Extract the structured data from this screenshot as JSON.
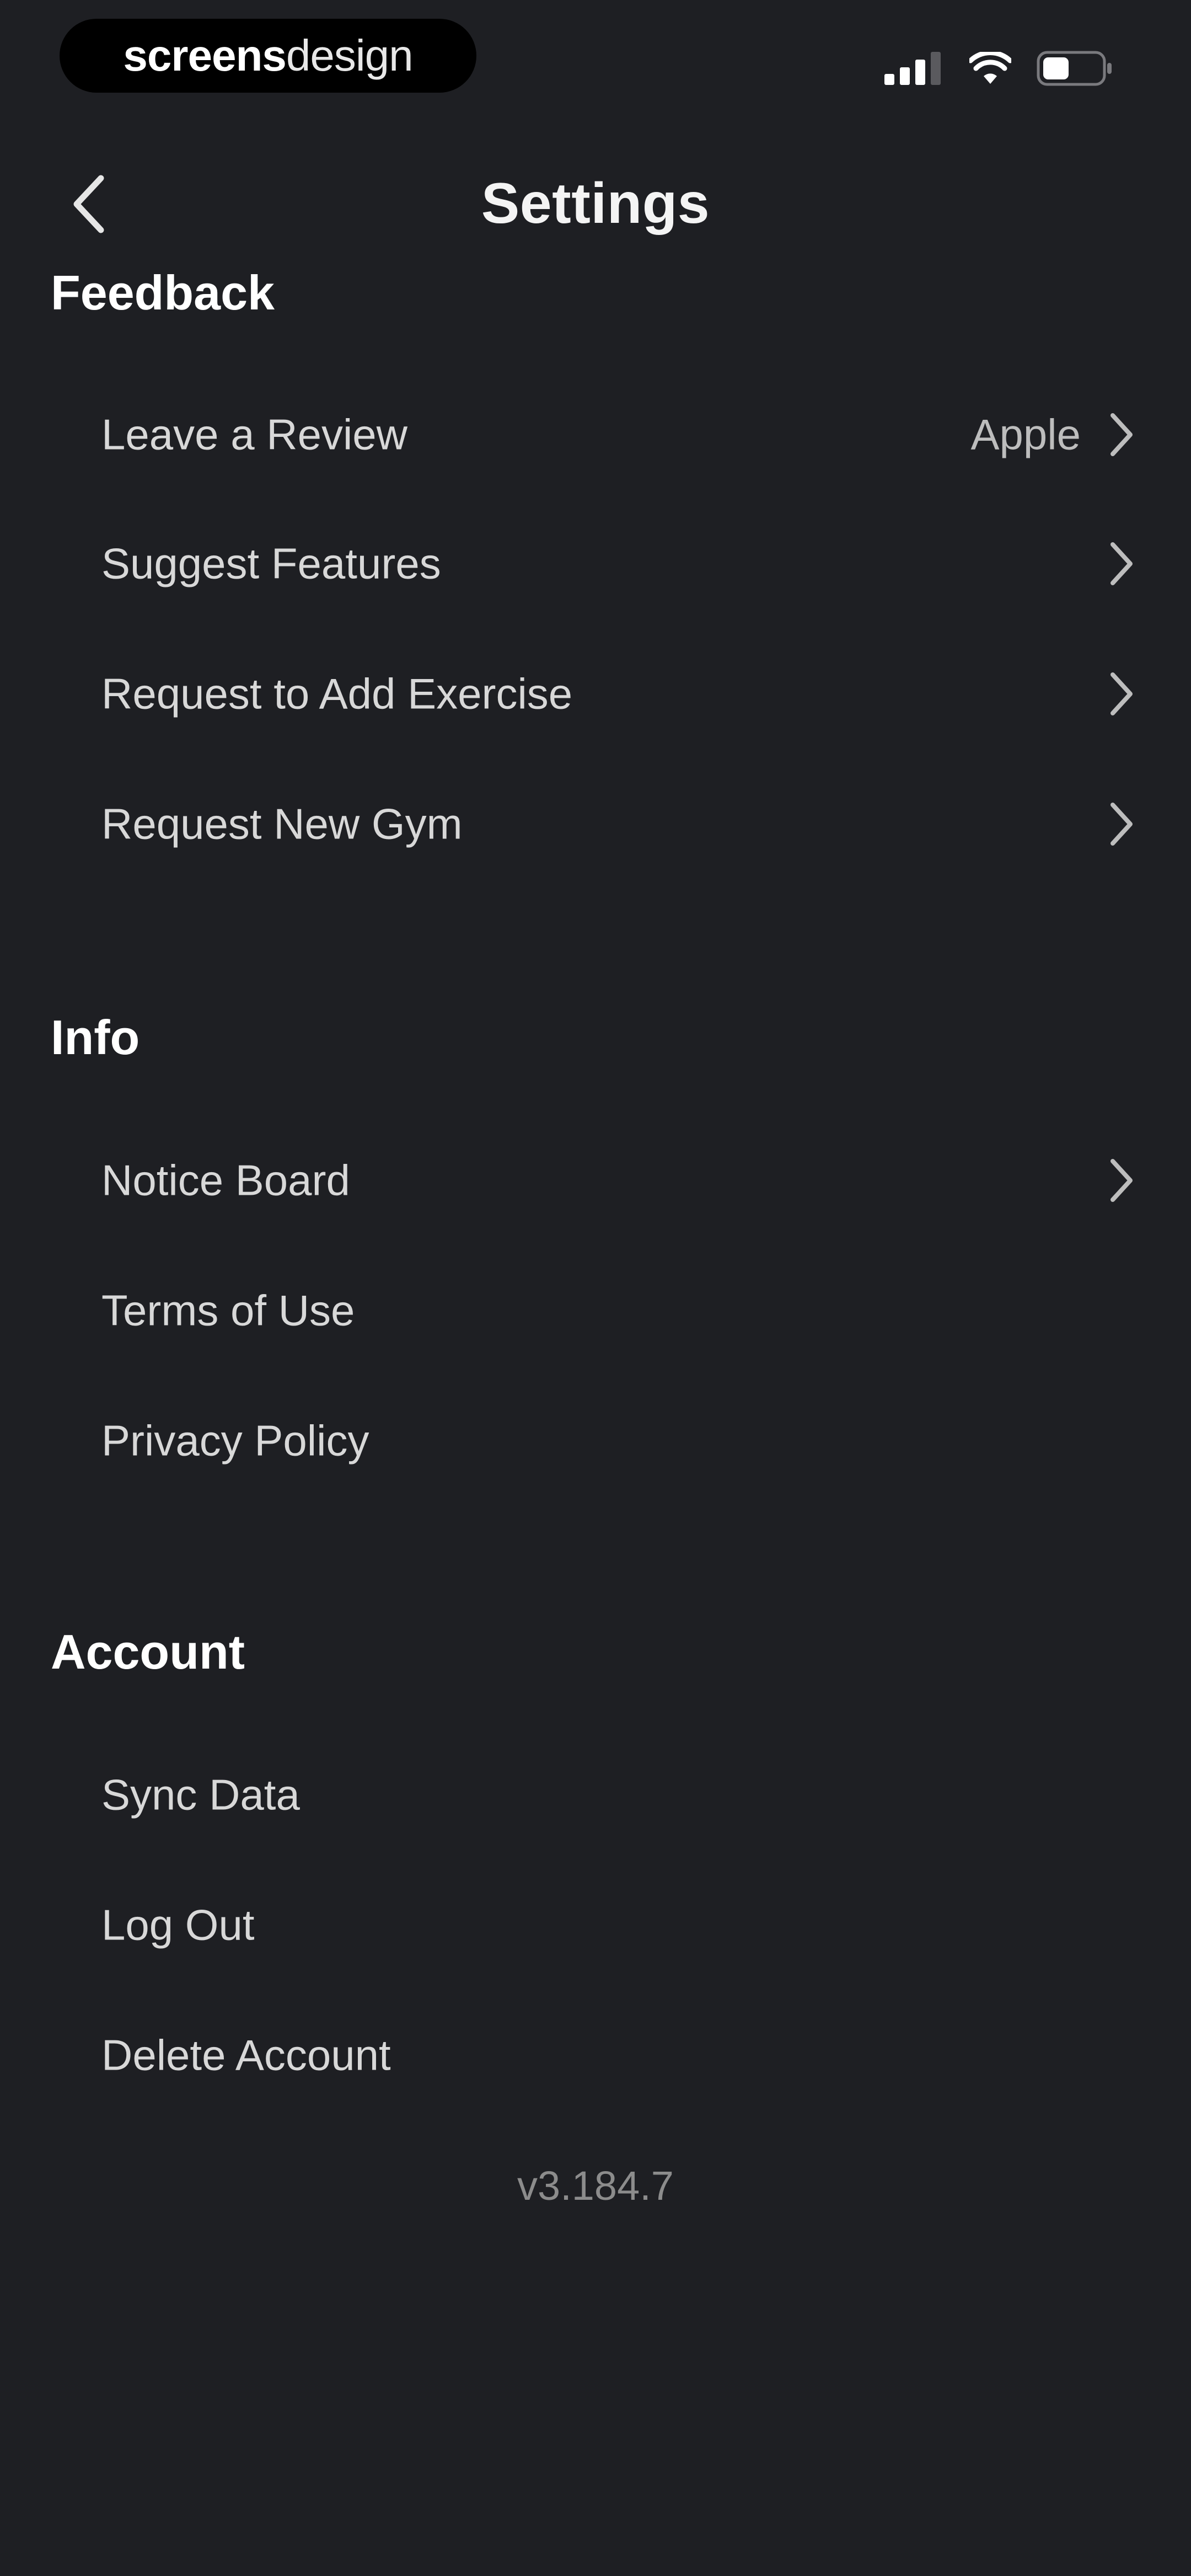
{
  "status_bar": {
    "brand_bold": "screens",
    "brand_light": "design",
    "icons": [
      "signal-icon",
      "wifi-icon",
      "battery-icon"
    ]
  },
  "header": {
    "title": "Settings",
    "back_icon": "chevron-left-icon"
  },
  "sections": {
    "feedback": {
      "title": "Feedback",
      "items": [
        {
          "label": "Leave a Review",
          "value": "Apple"
        },
        {
          "label": "Suggest Features"
        },
        {
          "label": "Request to Add Exercise"
        },
        {
          "label": "Request New Gym"
        }
      ]
    },
    "info": {
      "title": "Info",
      "items": [
        {
          "label": "Notice Board"
        },
        {
          "label": "Terms of Use"
        },
        {
          "label": "Privacy Policy"
        }
      ]
    },
    "account": {
      "title": "Account",
      "items": [
        {
          "label": "Sync Data"
        },
        {
          "label": "Log Out"
        },
        {
          "label": "Delete Account"
        }
      ]
    }
  },
  "version": "v3.184.7",
  "colors": {
    "background": "#1e1f23",
    "text_primary": "#ffffff",
    "text_secondary": "#d8d8d8",
    "text_muted": "#8c8c8c",
    "chevron": "#bdbdbd"
  }
}
